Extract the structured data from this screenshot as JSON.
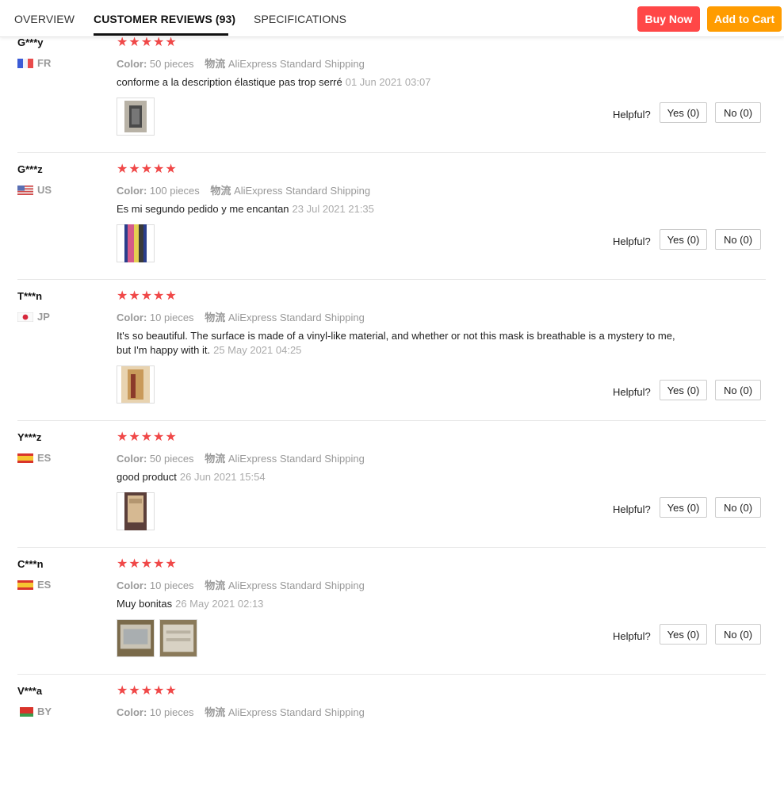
{
  "nav": {
    "tabs": [
      "OVERVIEW",
      "CUSTOMER REVIEWS (93)",
      "SPECIFICATIONS"
    ],
    "buy_now": "Buy Now",
    "add_to_cart": "Add to Cart",
    "accent_buy": "#ff4747",
    "accent_cart": "#ff9c00"
  },
  "labels": {
    "color": "Color:",
    "shipping_label": "物流",
    "helpful": "Helpful?",
    "stars": "★★★★★"
  },
  "reviews": [
    {
      "user": "G***y",
      "country": "FR",
      "color": "50 pieces",
      "shipping": "AliExpress Standard Shipping",
      "text": "conforme a la description élastique pas trop serré",
      "date": "01 Jun 2021 03:07",
      "rating": 5,
      "images": [
        "photo"
      ],
      "yes": "Yes (0)",
      "no": "No (0)"
    },
    {
      "user": "G***z",
      "country": "US",
      "color": "100 pieces",
      "shipping": "AliExpress Standard Shipping",
      "text": "Es mi segundo pedido y me encantan",
      "date": "23 Jul 2021 21:35",
      "rating": 5,
      "images": [
        "photo"
      ],
      "yes": "Yes (0)",
      "no": "No (0)"
    },
    {
      "user": "T***n",
      "country": "JP",
      "color": "10 pieces",
      "shipping": "AliExpress Standard Shipping",
      "text": "It's so beautiful. The surface is made of a vinyl-like material, and whether or not this mask is breathable is a mystery to me, but I'm happy with it.",
      "date": "25 May 2021 04:25",
      "rating": 5,
      "images": [
        "photo"
      ],
      "yes": "Yes (0)",
      "no": "No (0)"
    },
    {
      "user": "Y***z",
      "country": "ES",
      "color": "50 pieces",
      "shipping": "AliExpress Standard Shipping",
      "text": "good product",
      "date": "26 Jun 2021 15:54",
      "rating": 5,
      "images": [
        "photo"
      ],
      "yes": "Yes (0)",
      "no": "No (0)"
    },
    {
      "user": "C***n",
      "country": "ES",
      "color": "10 pieces",
      "shipping": "AliExpress Standard Shipping",
      "text": "Muy bonitas",
      "date": "26 May 2021 02:13",
      "rating": 5,
      "images": [
        "photo",
        "photo"
      ],
      "yes": "Yes (0)",
      "no": "No (0)"
    },
    {
      "user": "V***a",
      "country": "BY",
      "color": "10 pieces",
      "shipping": "AliExpress Standard Shipping",
      "text": "",
      "date": "",
      "rating": 5,
      "images": [],
      "yes": "",
      "no": ""
    }
  ]
}
